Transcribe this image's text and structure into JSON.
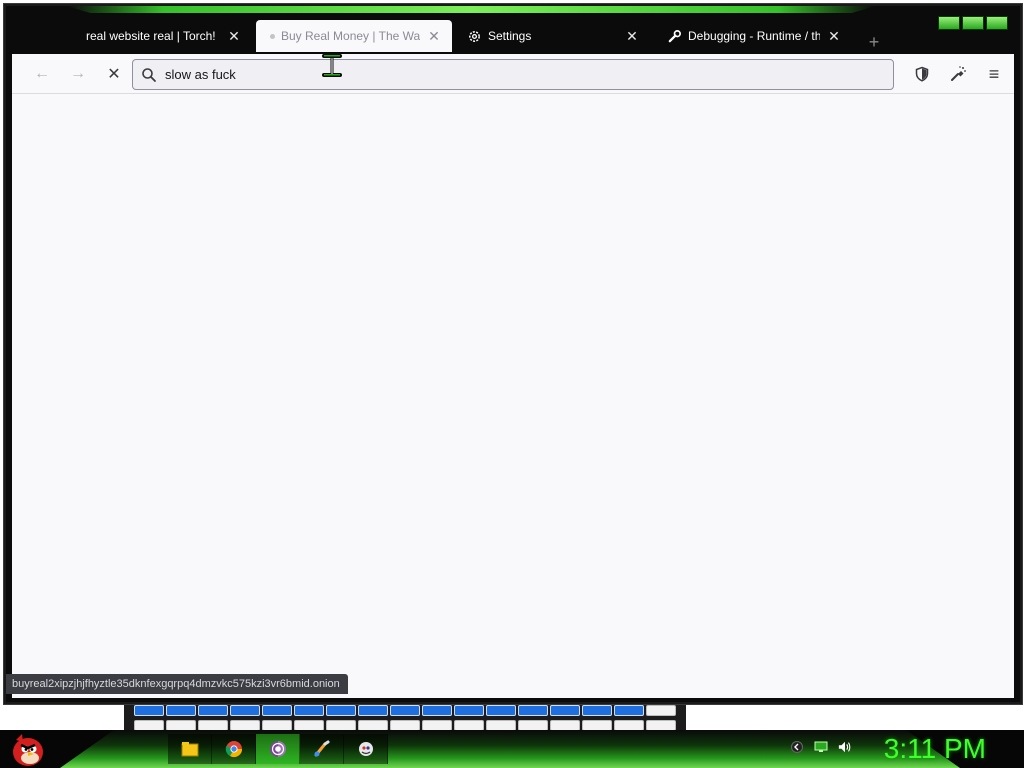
{
  "browser": {
    "tabs": [
      {
        "label": "real website real | Torch!",
        "close": "✕",
        "active": false,
        "icon": "none"
      },
      {
        "label": "Buy Real Money | The Way",
        "close": "✕",
        "active": true,
        "icon": "loading-dot"
      },
      {
        "label": "Settings",
        "close": "✕",
        "active": false,
        "icon": "gear-icon"
      },
      {
        "label": "Debugging - Runtime / this",
        "close": "✕",
        "active": false,
        "icon": "wrench-icon"
      }
    ],
    "new_tab": "+",
    "toolbar": {
      "back_icon": "←",
      "forward_icon": "→",
      "stop_icon": "✕",
      "url_value": "slow as fuck",
      "menu_icon": "≡"
    },
    "status_url": "buyreal2xipzjhjfhyztle35dknfexgqrpq4dmzvkc575kzi3vr6bmid.onion"
  },
  "taskbar": {
    "clock": "3:11 PM",
    "apps": [
      "file-explorer-icon",
      "chrome-icon",
      "tor-browser-icon",
      "paint-icon",
      "media-icon"
    ],
    "tray": [
      "tray-arrow-icon",
      "network-icon",
      "volume-icon"
    ]
  },
  "colors": {
    "accent_green": "#3dff2a",
    "chrome_dark": "#0b0b0b",
    "content_bg": "#f9f9fb"
  }
}
